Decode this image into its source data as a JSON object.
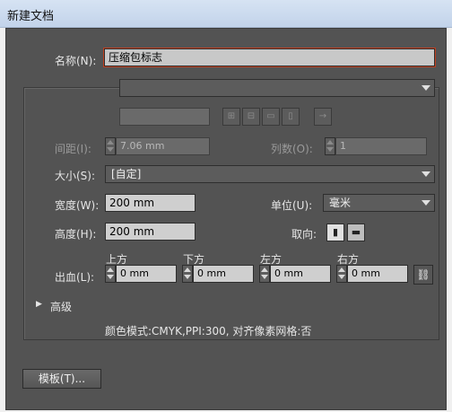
{
  "window": {
    "title": "新建文档"
  },
  "name_label": "名称(N):",
  "name_value": "压缩包标志",
  "spacing": {
    "label": "间距(I):",
    "value": "7.06 mm"
  },
  "columns": {
    "label": "列数(O):",
    "value": "1"
  },
  "size": {
    "label": "大小(S):",
    "value": "[自定]"
  },
  "width": {
    "label": "宽度(W):",
    "value": "200 mm"
  },
  "unit": {
    "label": "单位(U):",
    "value": "毫米"
  },
  "height": {
    "label": "高度(H):",
    "value": "200 mm"
  },
  "orientation": {
    "label": "取向:",
    "selected": "portrait"
  },
  "bleed": {
    "label": "出血(L):",
    "top_label": "上方",
    "top_value": "0 mm",
    "bottom_label": "下方",
    "bottom_value": "0 mm",
    "left_label": "左方",
    "left_value": "0 mm",
    "right_label": "右方",
    "right_value": "0 mm"
  },
  "advanced_label": "高级",
  "color_info": "颜色模式:CMYK,PPI:300, 对齐像素网格:否",
  "templates_button": "模板(T)...",
  "icons": {
    "artboard_layout": [
      "grid-by-row-icon",
      "grid-by-column-icon",
      "arrange-by-row-icon",
      "arrange-by-column-icon"
    ],
    "layout_direction": "arrow-right-icon",
    "link": "chain-link-icon",
    "disclosure": "triangle-right-icon"
  },
  "colors": {
    "dialog_bg": "#535353",
    "field_bg": "#cfcfcf",
    "focus_outline": "#c04020"
  }
}
